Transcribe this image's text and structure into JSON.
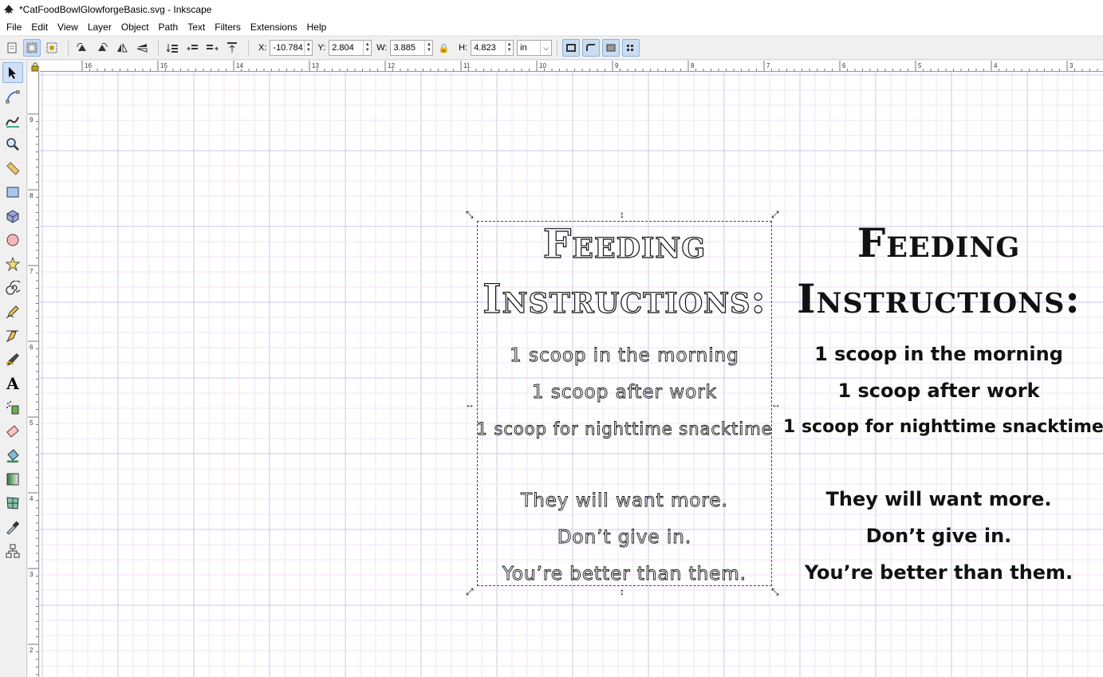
{
  "window": {
    "title": "*CatFoodBowlGlowforgeBasic.svg - Inkscape"
  },
  "menu": {
    "items": [
      {
        "label": "File",
        "key": "file"
      },
      {
        "label": "Edit",
        "key": "edit"
      },
      {
        "label": "View",
        "key": "view"
      },
      {
        "label": "Layer",
        "key": "layer"
      },
      {
        "label": "Object",
        "key": "object"
      },
      {
        "label": "Path",
        "key": "path"
      },
      {
        "label": "Text",
        "key": "text"
      },
      {
        "label": "Filters",
        "key": "filters"
      },
      {
        "label": "Extensions",
        "key": "extensions"
      },
      {
        "label": "Help",
        "key": "help"
      }
    ]
  },
  "toolbar": {
    "x_label": "X:",
    "x_value": "-10.784",
    "y_label": "Y:",
    "y_value": "2.804",
    "w_label": "W:",
    "w_value": "3.885",
    "h_label": "H:",
    "h_value": "4.823",
    "unit": "in"
  },
  "rulers": {
    "horizontal": [
      "16",
      "15",
      "14",
      "13",
      "12",
      "11",
      "10",
      "9",
      "8",
      "7",
      "6",
      "5",
      "4",
      "3"
    ],
    "vertical": [
      "9",
      "8",
      "7",
      "6",
      "5",
      "4",
      "3",
      "2"
    ]
  },
  "tools": [
    "selector-icon",
    "node-icon",
    "tweak-icon",
    "zoom-icon",
    "measure-icon",
    "rectangle-icon",
    "3dbox-icon",
    "ellipse-icon",
    "star-icon",
    "spiral-icon",
    "pencil-icon",
    "pen-icon",
    "calligraphy-icon",
    "text-icon",
    "spray-icon",
    "eraser-icon",
    "paint-bucket-icon",
    "gradient-icon",
    "mesh-icon",
    "dropper-icon",
    "connector-icon"
  ],
  "document": {
    "outline": {
      "title_line1": "Feeding",
      "title_line2": "Instructions:",
      "lines": [
        "1 scoop in the morning",
        "1 scoop after work",
        "1 scoop for nighttime snacktime"
      ],
      "footer": [
        "They will want more.",
        "Don’t give in.",
        "You’re better than them."
      ]
    },
    "solid": {
      "title_line1": "Feeding",
      "title_line2": "Instructions:",
      "lines": [
        "1 scoop in the morning",
        "1 scoop after work",
        "1 scoop for nighttime snacktime"
      ],
      "footer": [
        "They will want more.",
        "Don’t give in.",
        "You’re better than them."
      ]
    }
  },
  "colors": {
    "grid_minor": "#f1e3f4",
    "grid_major": "#c8c8ee",
    "selection": "#444444",
    "active_tool": "#cfe0f5"
  }
}
